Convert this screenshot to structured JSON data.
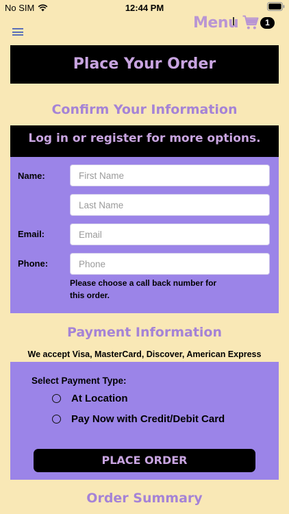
{
  "status_bar": {
    "carrier": "No SIM",
    "time": "12:44 PM"
  },
  "header": {
    "menu_label": "Menu",
    "cart_count": "1"
  },
  "page_title": "Place Your Order",
  "confirm_section": {
    "heading": "Confirm Your Information",
    "login_prompt": "Log in or register for more options.",
    "labels": {
      "name": "Name:",
      "email": "Email:",
      "phone": "Phone:"
    },
    "placeholders": {
      "first_name": "First Name",
      "last_name": "Last Name",
      "email": "Email",
      "phone": "Phone"
    },
    "phone_helper": "Please choose a call back number for this order."
  },
  "payment_section": {
    "heading": "Payment Information",
    "accepted_cards": "We accept Visa, MasterCard, Discover, American Express",
    "select_label": "Select Payment Type:",
    "options": [
      "At Location",
      "Pay Now with Credit/Debit Card"
    ],
    "place_order_label": "PLACE ORDER"
  },
  "summary_heading": "Order Summary",
  "colors": {
    "background": "#f9e8b6",
    "panel": "#9b84e8",
    "accent_text": "#a583d6",
    "band": "#000000"
  }
}
